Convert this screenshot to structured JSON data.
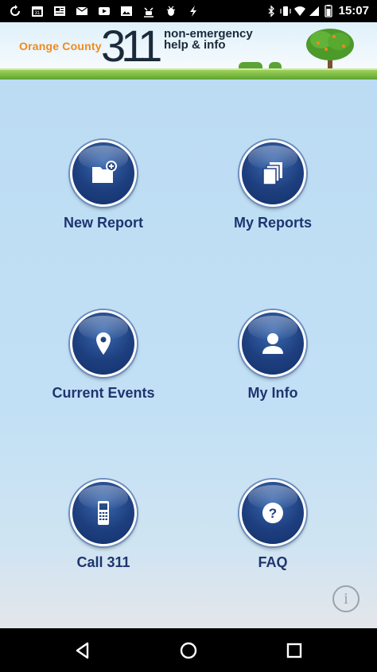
{
  "status_bar": {
    "time": "15:07",
    "left_icons": [
      "sync-icon",
      "calendar-icon",
      "news-icon",
      "mail-icon",
      "video-icon",
      "image-icon",
      "android-debug-icon",
      "bug-icon",
      "bolt-icon"
    ],
    "right_icons": [
      "bluetooth-icon",
      "vibrate-icon",
      "wifi-icon",
      "signal-icon",
      "battery-icon"
    ]
  },
  "header": {
    "brand_prefix": "Orange County",
    "brand_number": "311",
    "tagline_line1": "non-emergency",
    "tagline_line2": "help & info"
  },
  "tiles": [
    {
      "label": "New Report",
      "icon": "new-folder-icon"
    },
    {
      "label": "My Reports",
      "icon": "documents-icon"
    },
    {
      "label": "Current Events",
      "icon": "map-pin-icon"
    },
    {
      "label": "My Info",
      "icon": "person-icon"
    },
    {
      "label": "Call 311",
      "icon": "phone-icon"
    },
    {
      "label": "FAQ",
      "icon": "question-icon"
    }
  ],
  "info_button": {
    "glyph": "i"
  },
  "nav_bar": {
    "icons": [
      "back-icon",
      "home-icon",
      "recents-icon"
    ]
  },
  "colors": {
    "accent_blue": "#1e3f7f",
    "label_blue": "#1e3570",
    "brand_orange": "#f08a1d",
    "background": "#bcdcf3"
  }
}
